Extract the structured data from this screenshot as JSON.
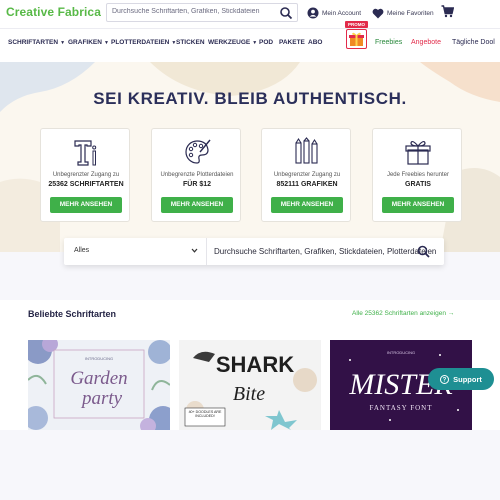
{
  "header": {
    "logo": "Creative Fabrica",
    "search_placeholder": "Durchsuche Schriftarten, Grafiken, Stickdateien",
    "account_label": "Mein Account",
    "favorites_label": "Meine Favoriten"
  },
  "nav": {
    "items": [
      {
        "label": "SCHRIFTARTEN",
        "dropdown": true
      },
      {
        "label": "GRAFIKEN",
        "dropdown": true
      },
      {
        "label": "PLOTTERDATEIEN",
        "dropdown": true
      },
      {
        "label": "STICKEN",
        "dropdown": false
      },
      {
        "label": "WERKZEUGE",
        "dropdown": true
      },
      {
        "label": "POD",
        "dropdown": false
      },
      {
        "label": "PAKETE",
        "dropdown": false
      },
      {
        "label": "ABO",
        "dropdown": false
      }
    ],
    "promo_tag": "PROMO",
    "freebies": "Freebies",
    "angebote": "Angebote",
    "daily": "Tägliche Dool"
  },
  "hero": {
    "title": "SEI KREATIV. BLEIB AUTHENTISCH.",
    "cards": [
      {
        "icon": "font-icon",
        "line1": "Unbegrenzter Zugang zu",
        "line2": "25362 SCHRIFTARTEN",
        "button": "MEHR ANSEHEN"
      },
      {
        "icon": "palette-icon",
        "line1": "Unbegrenzte Plotterdateien",
        "line2": "FÜR $12",
        "button": "MEHR ANSEHEN"
      },
      {
        "icon": "pencils-icon",
        "line1": "Unbegrenzter Zugang zu",
        "line2": "852111 GRAFIKEN",
        "button": "MEHR ANSEHEN"
      },
      {
        "icon": "gift-icon",
        "line1": "Jede Freebies herunter",
        "line2": "GRATIS",
        "button": "MEHR ANSEHEN"
      }
    ]
  },
  "search": {
    "category": "Alles",
    "placeholder": "Durchsuche Schriftarten, Grafiken, Stickdateien, Plotterdateien"
  },
  "fonts_section": {
    "title": "Beliebte Schriftarten",
    "view_all": "Alle 25362 Schriftarten anzeigen →",
    "cards": [
      {
        "intro": "INTRODUCING",
        "line1": "Garden",
        "line2": "party"
      },
      {
        "line1": "SHARK",
        "line2": "Bite",
        "badge": "40+ DOODLES ARE INCLUDED!"
      },
      {
        "intro": "INTRODUCING",
        "line1": "MISTER",
        "line2": "FANTASY FONT"
      }
    ]
  },
  "support_label": "Support",
  "colors": {
    "brand_green": "#58b947",
    "button_green": "#3fb049",
    "navy": "#2b2f5a",
    "promo_red": "#e22b4a",
    "support_teal": "#1e8f93"
  }
}
